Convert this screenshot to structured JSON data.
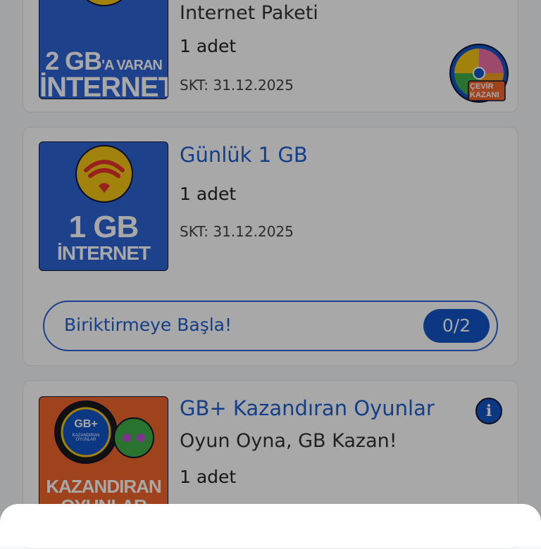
{
  "cards": [
    {
      "subtitle": "Internet Paketi",
      "quantity": "1 adet",
      "expiry": "SKT: 31.12.2025",
      "tile_line1": "2 GB",
      "tile_line1_suffix": "'A VARAN",
      "tile_line2": "İNTERNET",
      "wheel_label_1": "ÇEVİR",
      "wheel_label_2": "KAZANI"
    },
    {
      "title": "Günlük 1 GB",
      "quantity": "1 adet",
      "expiry": "SKT: 31.12.2025",
      "tile_line1": "1 GB",
      "tile_line2": "İNTERNET",
      "progress_label": "Biriktirmeye Başla!",
      "progress_count": "0/2",
      "progress_fraction": 0
    },
    {
      "title": "GB+ Kazandıran Oyunlar",
      "subtitle": "Oyun Oyna, GB Kazan!",
      "quantity": "1 adet",
      "tile_badge": "GB+",
      "tile_badge_sub": "KAZANDIRAN OYUNLAR",
      "tile_line1": "KAZANDIRAN",
      "tile_line2": "OYUNLAR",
      "info_icon": "i"
    }
  ],
  "colors": {
    "accent": "#1f5fcf",
    "tile_blue": "#2d63d3",
    "tile_orange": "#f0662b",
    "wifi_yellow": "#f3c614",
    "wifi_red": "#e8322c"
  }
}
